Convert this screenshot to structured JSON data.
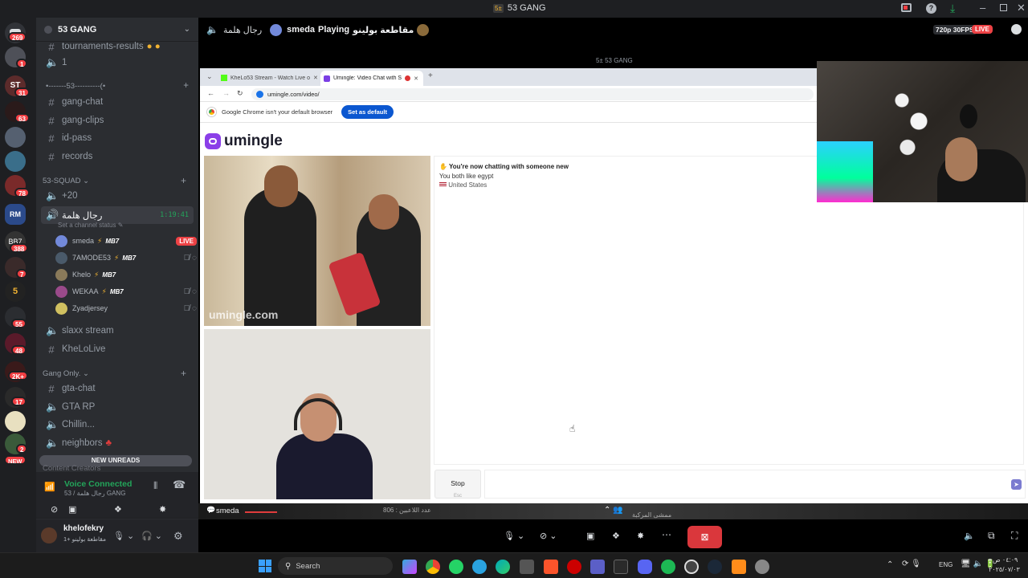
{
  "app": {
    "server_name": "53 GANG",
    "title_icon_text": "5±"
  },
  "servers": {
    "badges": [
      "269",
      "1",
      "31",
      "63",
      "78",
      "388",
      "7",
      "55",
      "48",
      "2K+",
      "17",
      "2",
      "NEW"
    ],
    "new_unreads": "NEW UNREADS"
  },
  "channels": {
    "items_top": [
      "tournaments-results",
      "1",
      "•-------53----------(•",
      "gang-chat",
      "gang-clips",
      "id-pass",
      "records"
    ],
    "squad_cat": "53-SQUAD",
    "plus20": "+20",
    "voice_channel": "رجال هلمة",
    "voice_timer": "1:19:41",
    "channel_status": "Set a channel status",
    "voice_users": [
      {
        "name": "smeda",
        "tag": "MB7",
        "live": "LIVE"
      },
      {
        "name": "7AMODE53",
        "tag": "MB7"
      },
      {
        "name": "Khelo",
        "tag": "MB7"
      },
      {
        "name": "WEKAA",
        "tag": "MB7"
      },
      {
        "name": "Zyadjersey",
        "tag": ""
      }
    ],
    "after_voice": [
      "slaxx stream",
      "KheLoLive"
    ],
    "gang_cat": "Gang Only.",
    "gang_items": [
      "gta-chat",
      "GTA RP",
      "Chillin...",
      "neighbors"
    ],
    "hidden_cat": "Content Creators"
  },
  "voice_panel": {
    "status": "Voice Connected",
    "sub": "53 / رجال هلمة GANG"
  },
  "user_panel": {
    "name": "khelofekry",
    "status": "مقاطعة بولينو +1"
  },
  "stream_header": {
    "voice_name": "رجال هلمة",
    "streamer": "smeda",
    "playing": "Playing",
    "game": "مقاطعة بولينو",
    "quality": "720p 30FPS",
    "live": "LIVE",
    "window_title": "53 GANG"
  },
  "browser": {
    "tab1": "KheLo53 Stream - Watch Live o",
    "tab2": "Umingle: Video Chat with S",
    "url": "umingle.com/video/",
    "notice": "Google Chrome isn't your default browser",
    "set_default": "Set as default"
  },
  "umingle": {
    "logo": "umingle",
    "chat_line1": "You're now chatting with someone new",
    "chat_line2": "You both like egypt",
    "chat_line3": "United States",
    "watermark": "umingle.com",
    "stop": "Stop",
    "stop_sub": "Esc"
  },
  "stream_bottom": {
    "viewer": "smeda",
    "stat1": "806 : عدد اللاعبين",
    "stat2": "ممشى المركبة"
  },
  "controls": {
    "colors": {
      "end": "#da373c",
      "mic": "#dbdee1"
    }
  },
  "taskbar": {
    "search": "Search",
    "lang": "ENG",
    "time": "٠٤:٠٩ ص",
    "date": "٢٠٢٥/٠٧/٠٣"
  }
}
